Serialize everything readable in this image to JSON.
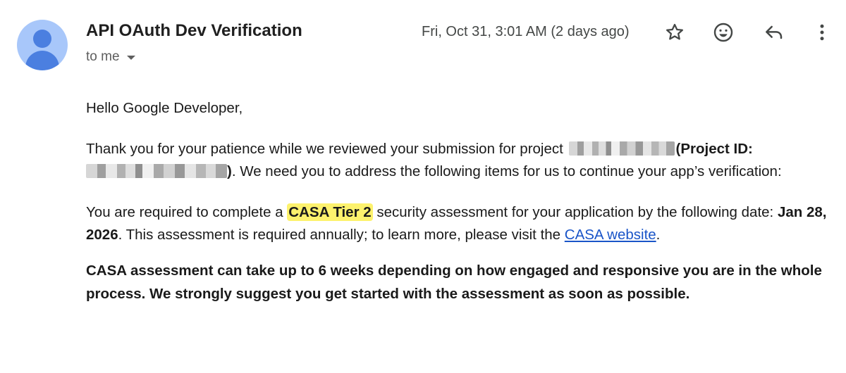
{
  "email": {
    "sender": "API OAuth Dev Verification",
    "recipient": "to me",
    "timestamp": "Fri, Oct 31, 3:01 AM (2 days ago)"
  },
  "icons": {
    "avatar": "avatar-icon",
    "star": "star-icon",
    "emoji": "emoji-icon",
    "reply": "reply-icon",
    "more": "more-vert-icon",
    "dropdown": "chevron-down-icon"
  },
  "colors": {
    "avatar_bg": "#a8c7fa",
    "avatar_fg": "#4b7fe0",
    "highlight": "#fdf26d",
    "link": "#1a55c8"
  },
  "body": {
    "greeting": "Hello Google Developer,",
    "thanks_prefix": "Thank you for your patience while we reviewed your submission for project ",
    "project_id_label": "(Project ID: ",
    "project_id_close": ")",
    "thanks_suffix": ". We need you to address the following items for us to continue your app’s verification:",
    "casa_prefix": "You are required to complete a ",
    "casa_tier": "CASA Tier 2",
    "casa_middle": " security assessment for your application by the following date: ",
    "casa_date": "Jan 28, 2026",
    "casa_suffix": ". This assessment is required annually; to learn more, please visit the ",
    "casa_link": "CASA website",
    "casa_end": ".",
    "warning": "CASA assessment can take up to 6 weeks depending on how engaged and responsive you are in the whole process. We strongly suggest you get started with the assessment as soon as possible."
  }
}
